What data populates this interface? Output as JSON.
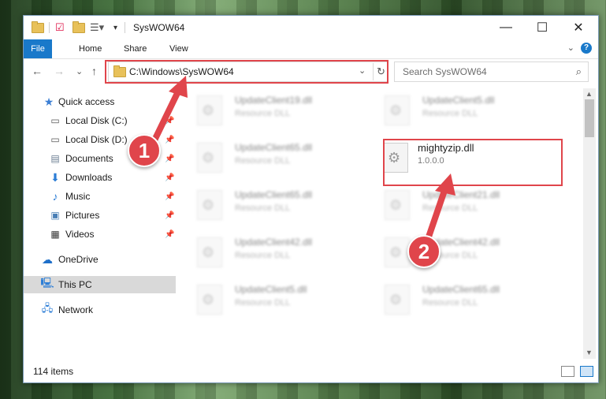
{
  "window": {
    "title": "SysWOW64",
    "controls": {
      "minimize": "—",
      "maximize": "☐",
      "close": "✕"
    }
  },
  "ribbon": {
    "tabs": [
      "File",
      "Home",
      "Share",
      "View"
    ],
    "help": "?"
  },
  "address": {
    "path": "C:\\Windows\\SysWOW64",
    "dropdown": "⌄",
    "refresh": "↻"
  },
  "search": {
    "placeholder": "Search SysWOW64",
    "icon": "magnifier-icon"
  },
  "nav": {
    "back": "←",
    "forward": "→",
    "recent": "⌄",
    "up": "↑",
    "items": [
      {
        "label": "Quick access",
        "icon": "star-icon"
      },
      {
        "label": "Local Disk (C:)",
        "icon": "drive-icon"
      },
      {
        "label": "Local Disk (D:)",
        "icon": "drive-icon"
      },
      {
        "label": "Documents",
        "icon": "documents-icon"
      },
      {
        "label": "Downloads",
        "icon": "download-icon"
      },
      {
        "label": "Music",
        "icon": "music-icon"
      },
      {
        "label": "Pictures",
        "icon": "pictures-icon"
      },
      {
        "label": "Videos",
        "icon": "videos-icon"
      },
      {
        "label": "OneDrive",
        "icon": "cloud-icon"
      },
      {
        "label": "This PC",
        "icon": "computer-icon"
      },
      {
        "label": "Network",
        "icon": "network-icon"
      }
    ]
  },
  "files": {
    "left": [
      {
        "name": "UpdateClient19.dll",
        "sub": "Resource DLL"
      },
      {
        "name": "UpdateClient65.dll",
        "sub": "Resource DLL"
      },
      {
        "name": "UpdateClient65.dll",
        "sub": "Resource DLL"
      },
      {
        "name": "UpdateClient42.dll",
        "sub": "Resource DLL"
      },
      {
        "name": "UpdateClient5.dll",
        "sub": "Resource DLL"
      }
    ],
    "right": [
      {
        "name": "UpdateClient5.dll",
        "sub": "Resource DLL"
      },
      {
        "name": "mightyzip.dll",
        "sub": "1.0.0.0"
      },
      {
        "name": "UpdateClient21.dll",
        "sub": "Resource DLL"
      },
      {
        "name": "UpdateClient42.dll",
        "sub": "Resource DLL"
      },
      {
        "name": "UpdateClient65.dll",
        "sub": "Resource DLL"
      }
    ]
  },
  "status": {
    "count": "114 items"
  },
  "callouts": {
    "one": "1",
    "two": "2"
  },
  "colors": {
    "accent": "#1979ca",
    "highlight": "#e0454b"
  }
}
